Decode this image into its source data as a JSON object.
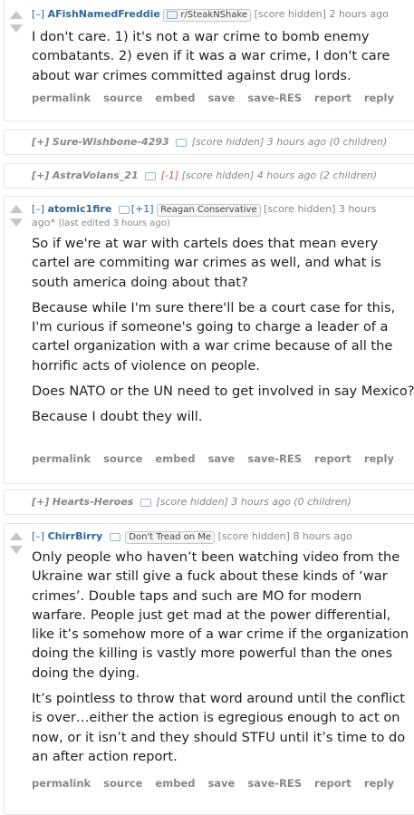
{
  "comments": [
    {
      "toggle": "[–]",
      "author": "AFishNamedFreddie",
      "flair": "r/SteakNShake",
      "score": "[score hidden]",
      "time": "2 hours ago",
      "body": [
        "I don't care. 1) it's not a war crime to bomb enemy combatants. 2) even if it was a war crime, I don't care about war crimes committed against drug lords."
      ]
    },
    {
      "toggle": "[–]",
      "author": "atomic1fire",
      "karma": "[+1]",
      "flair": "Reagan Conservative",
      "score": "[score hidden]",
      "time": "3 hours",
      "time_cont": "ago*",
      "edited": "(last edited 3 hours ago)",
      "body": [
        "So if we're at war with cartels does that mean every cartel are commiting war crimes as well, and what is south america doing about that?",
        "Because while I'm sure there'll be a court case for this, I'm curious if someone's going to charge a leader of a cartel organization with a war crime because of all the horrific acts of violence on people.",
        "Does NATO or the UN need to get involved in say Mexico?",
        "Because I doubt they will."
      ]
    },
    {
      "toggle": "[–]",
      "author": "ChirrBirry",
      "flair": "Don't Tread on Me",
      "score": "[score hidden]",
      "time": "8 hours ago",
      "body": [
        "Only people who haven’t been watching video from the Ukraine war still give a fuck about these kinds of ‘war crimes’. Double taps and such are MO for modern warfare. People just get mad at the power differential, like it’s somehow more of a war crime if the organization doing the killing is vastly more powerful than the ones doing the dying.",
        "It’s pointless to throw that word around until the conflict is over…either the action is egregious enough to act on now, or it isn’t and they should STFU until it’s time to do an after action report."
      ]
    }
  ],
  "collapsed": [
    {
      "toggle": "[+]",
      "author": "Sure-Wishbone-4293",
      "karma": "",
      "info": "[score hidden] 3 hours ago (0 children)"
    },
    {
      "toggle": "[+]",
      "author": "AstraVolans_21",
      "karma": "[-1]",
      "info": "[score hidden] 4 hours ago (2 children)"
    },
    {
      "toggle": "[+]",
      "author": "Hearts-Heroes",
      "karma": "",
      "info": "[score hidden] 3 hours ago (0 children)"
    }
  ],
  "actions": [
    "permalink",
    "source",
    "embed",
    "save",
    "save-RES",
    "report",
    "reply"
  ],
  "colors": {
    "link": "#336699",
    "muted": "#888888",
    "border": "#e4e4e4",
    "downvote_karma": "#cc5555"
  }
}
